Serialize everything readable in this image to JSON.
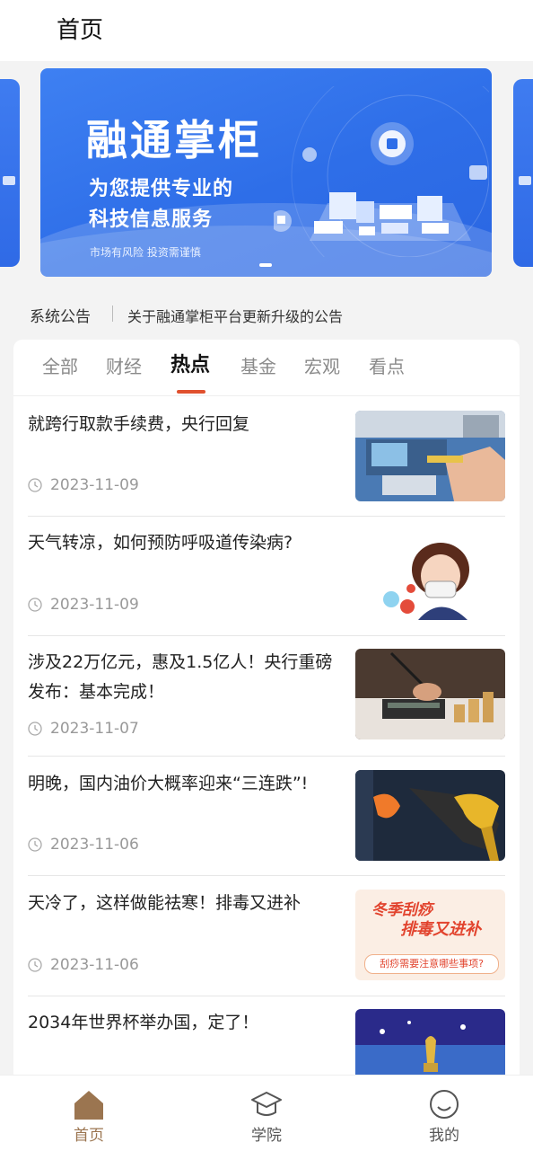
{
  "header": {
    "title": "首页"
  },
  "banner": {
    "brand": "融通掌柜",
    "line1": "为您提供专业的",
    "line2": "科技信息服务",
    "risk_note": "市场有风险 投资需谨慎"
  },
  "notice": {
    "tag": "系统公告",
    "text": "关于融通掌柜平台更新升级的公告"
  },
  "tabs": [
    {
      "label": "全部"
    },
    {
      "label": "财经"
    },
    {
      "label": "热点",
      "active": true
    },
    {
      "label": "基金"
    },
    {
      "label": "宏观"
    },
    {
      "label": "看点"
    }
  ],
  "news": [
    {
      "title": "就跨行取款手续费，央行回复",
      "date": "2023-11-09",
      "thumb": "atm-photo"
    },
    {
      "title": "天气转凉，如何预防呼吸道传染病?",
      "date": "2023-11-09",
      "thumb": "mask-illustration"
    },
    {
      "title": "涉及22万亿元，惠及1.5亿人！央行重磅发布：基本完成！",
      "date": "2023-11-07",
      "thumb": "calculator-coins-photo"
    },
    {
      "title": "明晚，国内油价大概率迎来“三连跌”!",
      "date": "2023-11-06",
      "thumb": "fuel-nozzle-photo"
    },
    {
      "title": "天冷了，这样做能祛寒！排毒又进补",
      "date": "2023-11-06",
      "thumb": "winter-poster",
      "thumb_text": {
        "line1": "冬季刮痧",
        "line2": "排毒又进补",
        "line3": "刮痧需要注意哪些事项?"
      }
    },
    {
      "title": "2034年世界杯举办国，定了！",
      "date": "",
      "thumb": "stadium-trophy-photo"
    }
  ],
  "bottom_nav": [
    {
      "label": "首页",
      "icon": "home-icon",
      "active": true
    },
    {
      "label": "学院",
      "icon": "graduation-cap-icon"
    },
    {
      "label": "我的",
      "icon": "smiley-face-icon"
    }
  ],
  "colors": {
    "accent_underline": "#e0502e",
    "active_nav": "#9b7550",
    "banner_blue": "#2e6ee8"
  }
}
